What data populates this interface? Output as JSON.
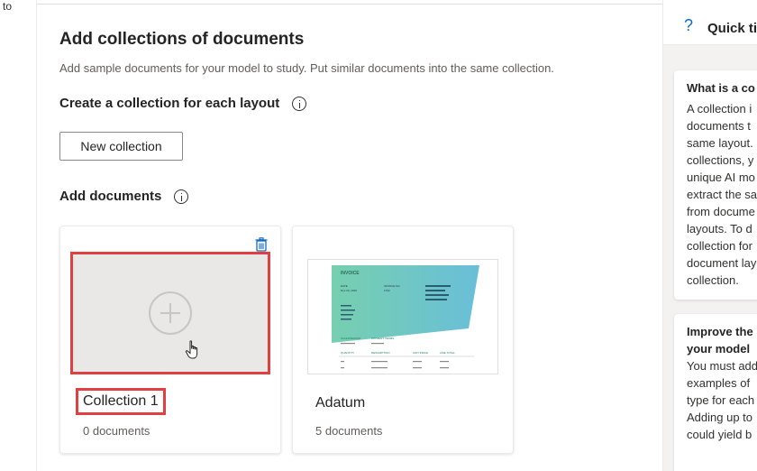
{
  "left_strip": {
    "fragment_text": "to"
  },
  "main": {
    "title": "Add collections of documents",
    "subtitle": "Add sample documents for your model to study. Put similar documents into the same collection.",
    "create_section_title": "Create a collection for each layout",
    "new_collection_label": "New collection",
    "add_documents_title": "Add documents"
  },
  "collections": [
    {
      "name": "Collection 1",
      "count": "0 documents",
      "icon_action": "trash-icon"
    },
    {
      "name": "Adatum",
      "count": "5 documents"
    }
  ],
  "invoice_thumb": {
    "title": "INVOICE",
    "date_label": "DATE",
    "date_value": "Dec 20, 2019",
    "invoice_no_label": "INVOICE NO",
    "invoice_no_value": "1702",
    "col_quantity": "QUANTITY",
    "col_description": "DESCRIPTION",
    "col_unit_price": "UNIT PRICE",
    "col_line_total": "LINE TOTAL",
    "salesperson": "SALESPERSON",
    "payment_terms": "PAYMENT TERMS",
    "accent_start": "#5ec7a1",
    "accent_end": "#4fb3d1"
  },
  "quick_tips": {
    "title": "Quick ti",
    "tip1_heading": "What is a co",
    "tip1_lines": [
      "A collection i",
      "documents t",
      "same layout.",
      "collections, y",
      "unique AI mo",
      "extract the sa",
      "from docume",
      "layouts. To d",
      "collection for",
      "document lay",
      "collection."
    ],
    "tip2_heading_lines": [
      "Improve the",
      "your model"
    ],
    "tip2_lines": [
      "You must add",
      "examples of",
      "type for each",
      "Adding up to",
      "could yield b"
    ]
  },
  "colors": {
    "highlight_red": "#e04040",
    "accent_blue": "#0f6cbd"
  }
}
